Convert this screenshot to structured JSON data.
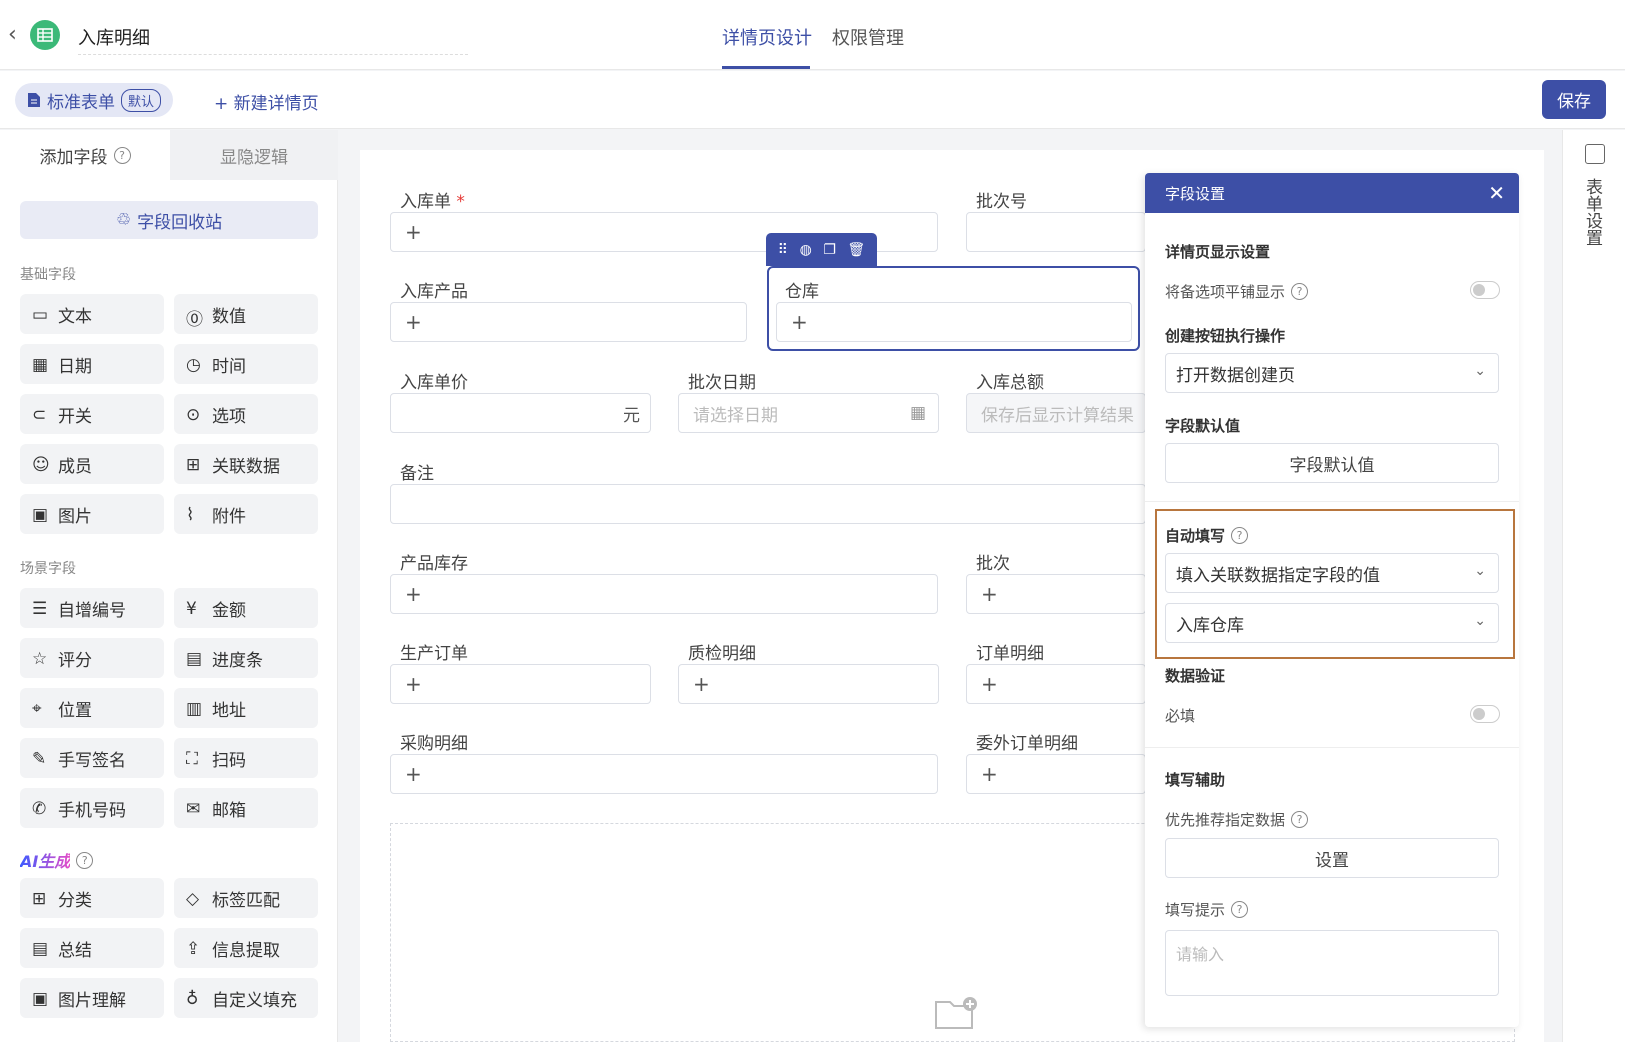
{
  "header": {
    "app_title": "入库明细",
    "tabs": [
      "详情页设计",
      "权限管理"
    ]
  },
  "subbar": {
    "std_form": "标准表单",
    "default_badge": "默认",
    "new_detail": "+ 新建详情页",
    "save": "保存"
  },
  "left": {
    "tab_add": "添加字段",
    "tab_logic": "显隐逻辑",
    "recycle": "字段回收站",
    "basic_title": "基础字段",
    "basic": [
      "文本",
      "数值",
      "日期",
      "时间",
      "开关",
      "选项",
      "成员",
      "关联数据",
      "图片",
      "附件"
    ],
    "scene_title": "场景字段",
    "scene": [
      "自增编号",
      "金额",
      "评分",
      "进度条",
      "位置",
      "地址",
      "手写签名",
      "扫码",
      "手机号码",
      "邮箱"
    ],
    "ai_title": "AI生成",
    "ai": [
      "分类",
      "标签匹配",
      "总结",
      "信息提取",
      "图片理解",
      "自定义填充"
    ]
  },
  "form": {
    "f1": "入库单",
    "f2": "批次号",
    "f3": "入库产品",
    "f4": "仓库",
    "f5": "入库单价",
    "f5_suffix": "元",
    "f6": "批次日期",
    "f6_placeholder": "请选择日期",
    "f7": "入库总额",
    "f7_placeholder": "保存后显示计算结果",
    "f8": "备注",
    "f9": "产品库存",
    "f10": "批次",
    "f11": "生产订单",
    "f12": "质检明细",
    "f13": "订单明细",
    "f14": "采购明细",
    "f15": "委外订单明细",
    "plus": "+"
  },
  "settings": {
    "title": "字段设置",
    "display_section": "详情页显示设置",
    "tile_option": "将备选项平铺显示",
    "create_btn_section": "创建按钮执行操作",
    "create_btn_value": "打开数据创建页",
    "default_section": "字段默认值",
    "default_btn": "字段默认值",
    "autofill_section": "自动填写",
    "autofill_mode": "填入关联数据指定字段的值",
    "autofill_field": "入库仓库",
    "validation_section": "数据验证",
    "required": "必填",
    "assist_section": "填写辅助",
    "recommend": "优先推荐指定数据",
    "set_btn": "设置",
    "hint_label": "填写提示",
    "hint_placeholder": "请输入"
  },
  "right_strip": {
    "label": "表单设置"
  }
}
